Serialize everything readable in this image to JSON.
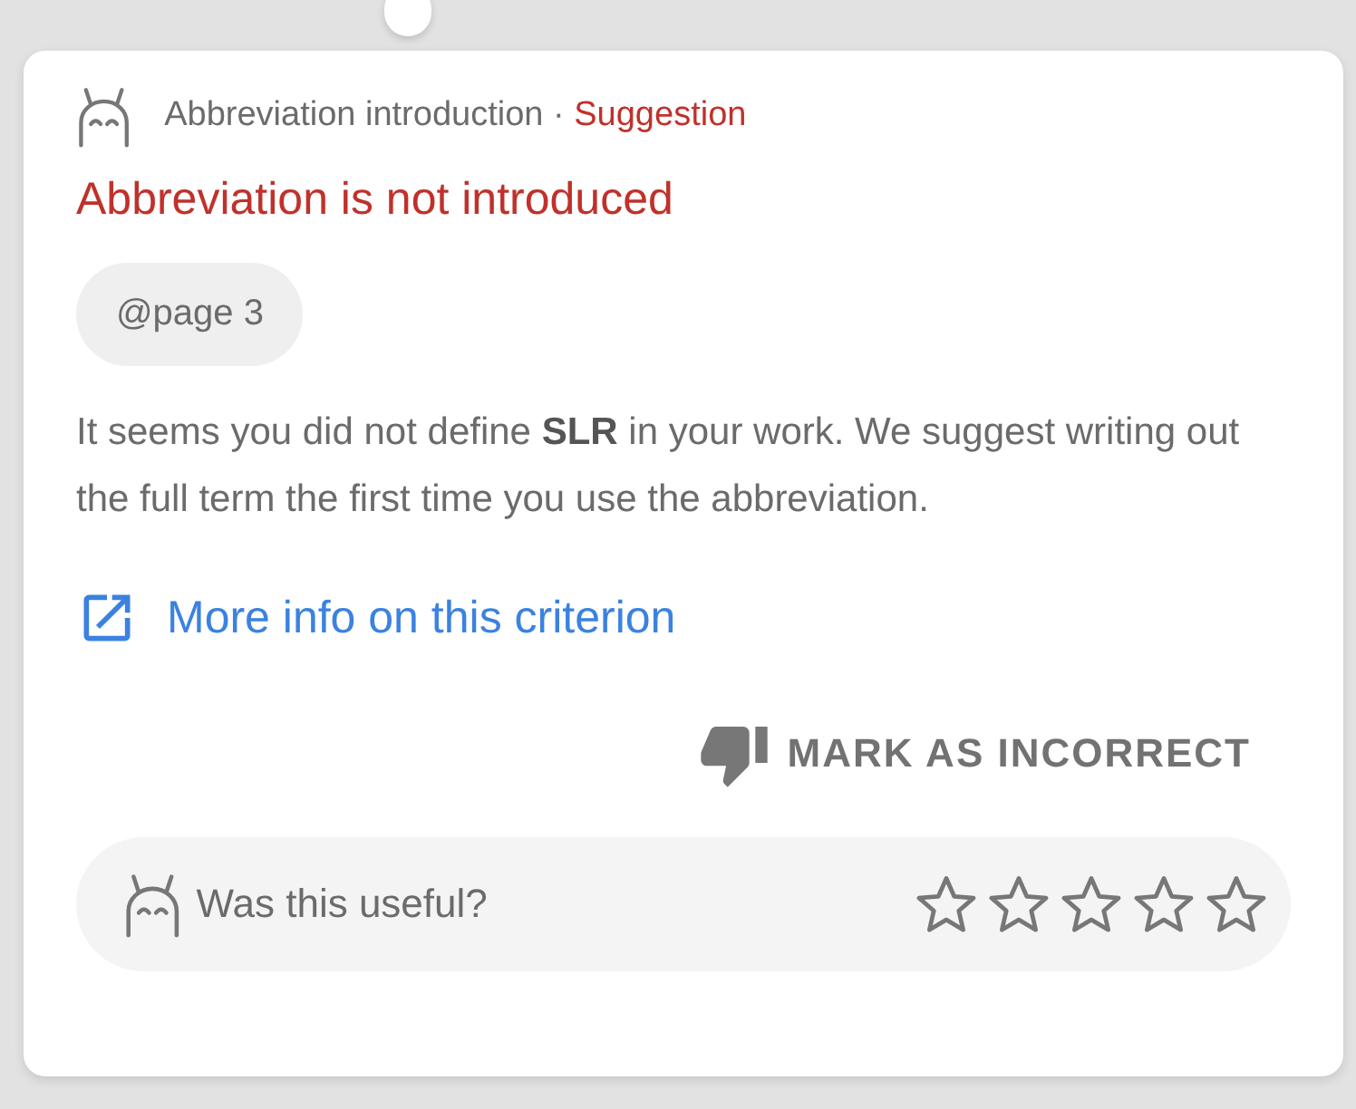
{
  "header": {
    "category": "Abbreviation introduction",
    "separator": "·",
    "severity": "Suggestion"
  },
  "title": "Abbreviation is not introduced",
  "location_chip": "@page 3",
  "message": "It seems you did not define **SLR** in your work. We suggest writing out the full term the first time you use the abbreviation.",
  "more_info_link": "More info on this criterion",
  "mark_incorrect_button": "MARK AS INCORRECT",
  "feedback": {
    "question": "Was this useful?",
    "stars": 0
  }
}
